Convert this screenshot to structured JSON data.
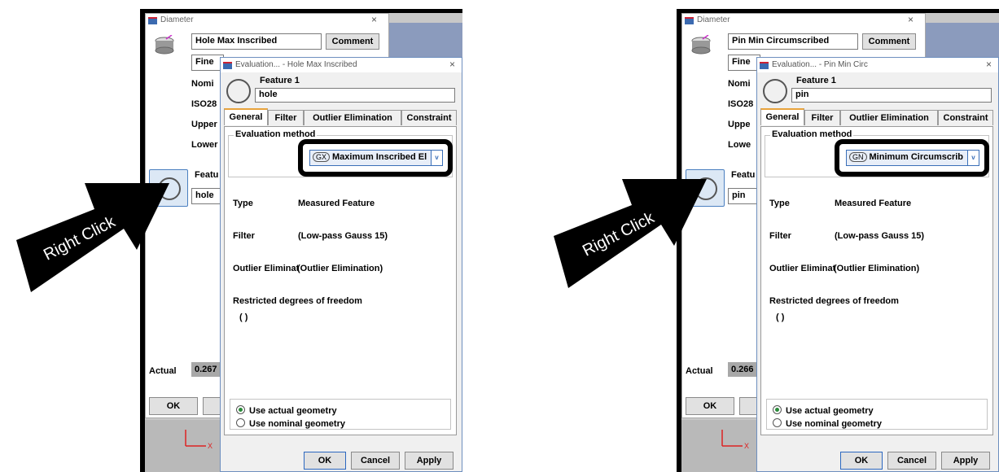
{
  "panels": [
    {
      "parent_dialog": {
        "title": "Diameter",
        "close": "×",
        "name_value": "Hole Max Inscribed",
        "comment_label": "Comment",
        "fine_label": "Fine",
        "row_labels": [
          "Nomi",
          "ISO28",
          "Upper",
          "Lower"
        ],
        "feature_label": "Featu",
        "feature_value": "hole",
        "actual_label": "Actual",
        "actual_value": "0.267",
        "ok_label": "OK"
      },
      "eval_dialog": {
        "title": "Evaluation... - Hole Max Inscribed",
        "close": "×",
        "feature_label": "Feature 1",
        "feature_value": "hole",
        "tabs": [
          "General",
          "Filter",
          "Outlier Elimination",
          "Constraint"
        ],
        "method_group_label": "Evaluation method",
        "method_badge": "GX",
        "method_value": "Maximum Inscribed El",
        "dropdown_arrow": "v",
        "type_label": "Type",
        "type_value": "Measured Feature",
        "filter_label": "Filter",
        "filter_value": "(Low-pass Gauss 15)",
        "outlier_label": "Outlier Eliminat",
        "outlier_value": "(Outlier Elimination)",
        "restricted_label": "Restricted degrees of freedom",
        "restricted_value": "( )",
        "radio_actual": "Use actual geometry",
        "radio_nominal": "Use nominal geometry",
        "ok": "OK",
        "cancel": "Cancel",
        "apply": "Apply"
      },
      "arrow_text": "Right Click",
      "axis_label": "X"
    },
    {
      "parent_dialog": {
        "title": "Diameter",
        "close": "×",
        "name_value": "Pin Min Circumscribed",
        "comment_label": "Comment",
        "fine_label": "Fine",
        "row_labels": [
          "Nomi",
          "ISO28",
          "Uppe",
          "Lowe"
        ],
        "feature_label": "Featu",
        "feature_value": "pin",
        "actual_label": "Actual",
        "actual_value": "0.266",
        "ok_label": "OK"
      },
      "eval_dialog": {
        "title": "Evaluation... - Pin Min Circ",
        "close": "×",
        "feature_label": "Feature 1",
        "feature_value": "pin",
        "tabs": [
          "General",
          "Filter",
          "Outlier Elimination",
          "Constraint"
        ],
        "method_group_label": "Evaluation method",
        "method_badge": "GN",
        "method_value": "Minimum Circumscrib",
        "dropdown_arrow": "v",
        "type_label": "Type",
        "type_value": "Measured Feature",
        "filter_label": "Filter",
        "filter_value": "(Low-pass Gauss 15)",
        "outlier_label": "Outlier Eliminat",
        "outlier_value": "(Outlier Elimination)",
        "restricted_label": "Restricted degrees of freedom",
        "restricted_value": "( )",
        "radio_actual": "Use actual geometry",
        "radio_nominal": "Use nominal geometry",
        "ok": "OK",
        "cancel": "Cancel",
        "apply": "Apply"
      },
      "arrow_text": "Right Click",
      "axis_label": "X"
    }
  ],
  "colors": {
    "highlight_border": "#000000",
    "active_tab_accent": "#e8a33c",
    "radio_selected": "#2a8a3a",
    "combo_border": "#3a6fb8"
  }
}
